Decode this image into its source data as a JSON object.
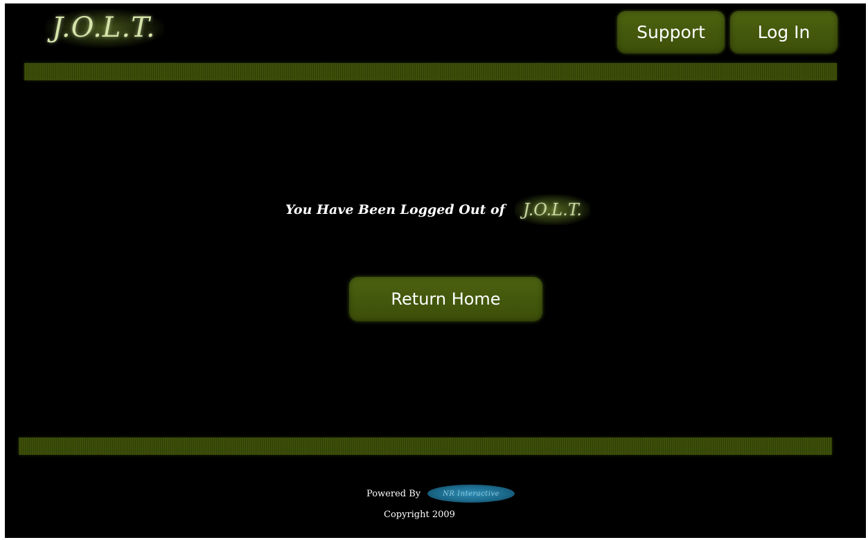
{
  "header": {
    "logo_text": "J.O.L.T.",
    "nav": {
      "support_label": "Support",
      "login_label": "Log In"
    }
  },
  "main": {
    "message": "You Have Been Logged Out of",
    "inline_logo_text": "J.O.L.T.",
    "return_button_label": "Return Home"
  },
  "footer": {
    "powered_by_label": "Powered By",
    "partner_logo_text": "NR Interactive",
    "copyright": "Copyright 2009"
  },
  "colors": {
    "background": "#000000",
    "accent_green": "#4d6310",
    "logo_text": "#d5e4a9",
    "partner_logo_blue": "#1c6a8c"
  }
}
